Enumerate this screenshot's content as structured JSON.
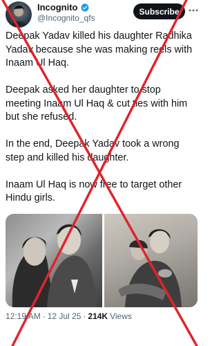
{
  "author": {
    "display_name": "Incognito",
    "handle": "@Incognito_qfs",
    "verified_icon": "verified-badge-icon",
    "verified_color": "#1d9bf0"
  },
  "actions": {
    "subscribe_label": "Subscribe",
    "more_icon": "more-options-icon"
  },
  "post": {
    "paragraphs": [
      "Deepak Yadav killed his daughter Radhika Yadav because she was making reels with Inaam Ul Haq.",
      "Deepak asked her daughter to stop meeting Inaam Ul Haq & cut ties with him but she refused.",
      "In the end, Deepak Yadav took a wrong step and killed his daughter.",
      "Inaam Ul Haq is now free to target other Hindu girls."
    ]
  },
  "media": {
    "photos": [
      "couple-portrait-photo",
      "scooter-ride-photo"
    ]
  },
  "meta": {
    "time": "12:19 AM",
    "separator": "·",
    "date": "12 Jul 25",
    "views_count": "214K",
    "views_label": "Views"
  },
  "overlay": {
    "cross_color": "#e0242b"
  }
}
